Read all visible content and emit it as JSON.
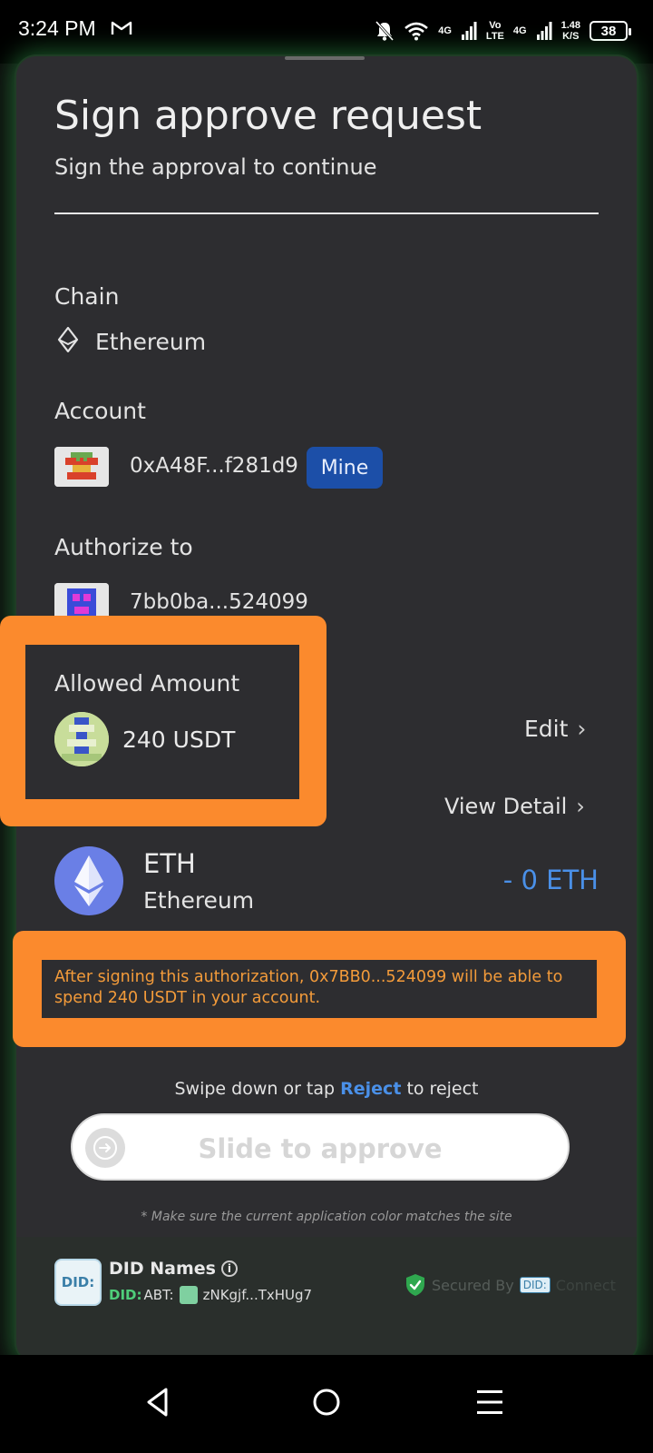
{
  "status_bar": {
    "time": "3:24 PM",
    "network_1": "4G",
    "volte_1": "Vo",
    "volte_2": "LTE",
    "network_2": "4G",
    "speed_value": "1.48",
    "speed_unit": "K/S",
    "battery": "38"
  },
  "header": {
    "title": "Sign approve request",
    "subtitle": "Sign the approval to continue"
  },
  "chain": {
    "label": "Chain",
    "value": "Ethereum",
    "icon": "ethereum-diamond-icon"
  },
  "account": {
    "label": "Account",
    "address": "0xA48F...f281d9",
    "badge": "Mine"
  },
  "authorize": {
    "label": "Authorize to",
    "address": "7bb0ba...524099"
  },
  "allowed_amount": {
    "label": "Allowed Amount",
    "value": "240 USDT",
    "edit_label": "Edit"
  },
  "balance_change": {
    "view_detail_label": "View Detail",
    "symbol": "ETH",
    "name": "Ethereum",
    "delta": "- 0 ETH"
  },
  "warning": {
    "text": "After signing this authorization, 0x7BB0...524099 will be able to spend 240 USDT in your account."
  },
  "actions": {
    "swipe_prefix": "Swipe down or tap ",
    "reject_label": "Reject",
    "swipe_suffix": " to reject",
    "slide_label": "Slide to approve",
    "note": "* Make sure the current application color matches the site"
  },
  "footer": {
    "logo_text": "DID:",
    "app_name": "DID Names",
    "did_prefix": "DID:",
    "did_type": "ABT:",
    "did_address": "zNKgjf...TxHUg7",
    "secured_label": "Secured By",
    "secured_brand": "DID:",
    "secured_connect": "Connect"
  },
  "colors": {
    "sheet_bg": "#2d2d30",
    "highlight": "#fb8a2d",
    "accent_blue": "#4a90e8",
    "badge_blue": "#1c4fa8",
    "glow_green": "#3cbe5a"
  }
}
